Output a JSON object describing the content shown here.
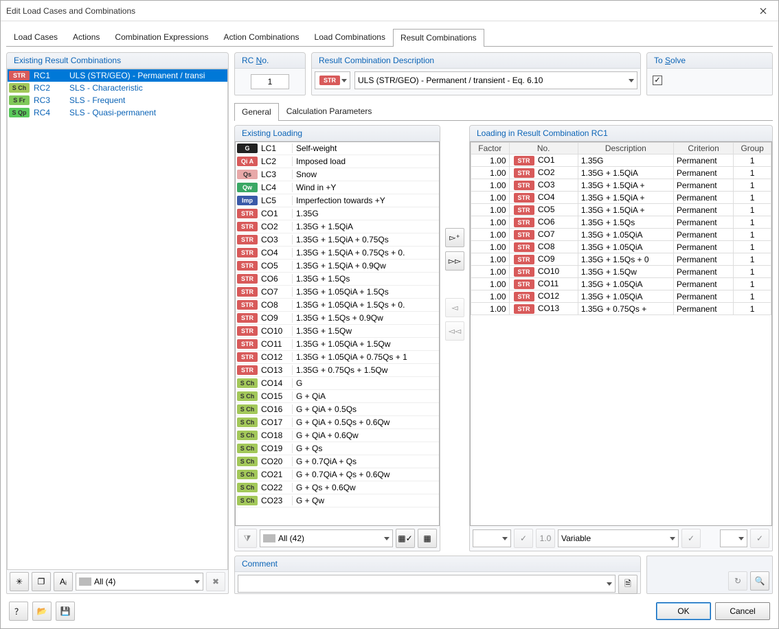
{
  "window": {
    "title": "Edit Load Cases and Combinations"
  },
  "mainTabs": [
    "Load Cases",
    "Actions",
    "Combination Expressions",
    "Action Combinations",
    "Load Combinations",
    "Result Combinations"
  ],
  "mainTabActive": 5,
  "left": {
    "header": "Existing Result Combinations",
    "rows": [
      {
        "tag": "STR",
        "tagcls": "tag-STR",
        "num": "RC1",
        "desc": "ULS (STR/GEO) - Permanent / transi",
        "sel": true
      },
      {
        "tag": "S Ch",
        "tagcls": "tag-SCh",
        "num": "RC2",
        "desc": "SLS - Characteristic"
      },
      {
        "tag": "S Fr",
        "tagcls": "tag-SFr",
        "num": "RC3",
        "desc": "SLS - Frequent"
      },
      {
        "tag": "S Qp",
        "tagcls": "tag-SQp",
        "num": "RC4",
        "desc": "SLS - Quasi-permanent"
      }
    ],
    "filter": "All (4)"
  },
  "rcNo": {
    "header": "RC No.",
    "value": "1"
  },
  "rcDesc": {
    "header": "Result Combination Description",
    "badge": "STR",
    "value": "ULS (STR/GEO) - Permanent / transient - Eq. 6.10"
  },
  "solve": {
    "header": "To Solve",
    "checked": true
  },
  "subTabs": [
    "General",
    "Calculation Parameters"
  ],
  "subTabActive": 0,
  "existLoad": {
    "header": "Existing Loading",
    "rows": [
      {
        "tag": "G",
        "tagcls": "tag-G",
        "code": "LC1",
        "desc": "Self-weight"
      },
      {
        "tag": "Qi A",
        "tagcls": "tag-QiA",
        "code": "LC2",
        "desc": "Imposed load"
      },
      {
        "tag": "Qs",
        "tagcls": "tag-Qs",
        "code": "LC3",
        "desc": "Snow"
      },
      {
        "tag": "Qw",
        "tagcls": "tag-Qw",
        "code": "LC4",
        "desc": "Wind in +Y"
      },
      {
        "tag": "Imp",
        "tagcls": "tag-Imp",
        "code": "LC5",
        "desc": "Imperfection towards +Y"
      },
      {
        "tag": "STR",
        "tagcls": "tag-STR",
        "code": "CO1",
        "desc": "1.35G"
      },
      {
        "tag": "STR",
        "tagcls": "tag-STR",
        "code": "CO2",
        "desc": "1.35G + 1.5QiA"
      },
      {
        "tag": "STR",
        "tagcls": "tag-STR",
        "code": "CO3",
        "desc": "1.35G + 1.5QiA + 0.75Qs"
      },
      {
        "tag": "STR",
        "tagcls": "tag-STR",
        "code": "CO4",
        "desc": "1.35G + 1.5QiA + 0.75Qs + 0."
      },
      {
        "tag": "STR",
        "tagcls": "tag-STR",
        "code": "CO5",
        "desc": "1.35G + 1.5QiA + 0.9Qw"
      },
      {
        "tag": "STR",
        "tagcls": "tag-STR",
        "code": "CO6",
        "desc": "1.35G + 1.5Qs"
      },
      {
        "tag": "STR",
        "tagcls": "tag-STR",
        "code": "CO7",
        "desc": "1.35G + 1.05QiA + 1.5Qs"
      },
      {
        "tag": "STR",
        "tagcls": "tag-STR",
        "code": "CO8",
        "desc": "1.35G + 1.05QiA + 1.5Qs + 0."
      },
      {
        "tag": "STR",
        "tagcls": "tag-STR",
        "code": "CO9",
        "desc": "1.35G + 1.5Qs + 0.9Qw"
      },
      {
        "tag": "STR",
        "tagcls": "tag-STR",
        "code": "CO10",
        "desc": "1.35G + 1.5Qw"
      },
      {
        "tag": "STR",
        "tagcls": "tag-STR",
        "code": "CO11",
        "desc": "1.35G + 1.05QiA + 1.5Qw"
      },
      {
        "tag": "STR",
        "tagcls": "tag-STR",
        "code": "CO12",
        "desc": "1.35G + 1.05QiA + 0.75Qs + 1"
      },
      {
        "tag": "STR",
        "tagcls": "tag-STR",
        "code": "CO13",
        "desc": "1.35G + 0.75Qs + 1.5Qw"
      },
      {
        "tag": "S Ch",
        "tagcls": "tag-SCh",
        "code": "CO14",
        "desc": "G"
      },
      {
        "tag": "S Ch",
        "tagcls": "tag-SCh",
        "code": "CO15",
        "desc": "G + QiA"
      },
      {
        "tag": "S Ch",
        "tagcls": "tag-SCh",
        "code": "CO16",
        "desc": "G + QiA + 0.5Qs"
      },
      {
        "tag": "S Ch",
        "tagcls": "tag-SCh",
        "code": "CO17",
        "desc": "G + QiA + 0.5Qs + 0.6Qw"
      },
      {
        "tag": "S Ch",
        "tagcls": "tag-SCh",
        "code": "CO18",
        "desc": "G + QiA + 0.6Qw"
      },
      {
        "tag": "S Ch",
        "tagcls": "tag-SCh",
        "code": "CO19",
        "desc": "G + Qs"
      },
      {
        "tag": "S Ch",
        "tagcls": "tag-SCh",
        "code": "CO20",
        "desc": "G + 0.7QiA + Qs"
      },
      {
        "tag": "S Ch",
        "tagcls": "tag-SCh",
        "code": "CO21",
        "desc": "G + 0.7QiA + Qs + 0.6Qw"
      },
      {
        "tag": "S Ch",
        "tagcls": "tag-SCh",
        "code": "CO22",
        "desc": "G + Qs + 0.6Qw"
      },
      {
        "tag": "S Ch",
        "tagcls": "tag-SCh",
        "code": "CO23",
        "desc": "G + Qw"
      }
    ],
    "filter": "All (42)"
  },
  "rcRes": {
    "header": "Loading in Result Combination RC1",
    "cols": [
      "Factor",
      "No.",
      "Description",
      "Criterion",
      "Group"
    ],
    "rows": [
      {
        "f": "1.00",
        "tag": "STR",
        "no": "CO1",
        "d": "1.35G",
        "c": "Permanent",
        "g": "1"
      },
      {
        "f": "1.00",
        "tag": "STR",
        "no": "CO2",
        "d": "1.35G + 1.5QiA",
        "c": "Permanent",
        "g": "1"
      },
      {
        "f": "1.00",
        "tag": "STR",
        "no": "CO3",
        "d": "1.35G + 1.5QiA +",
        "c": "Permanent",
        "g": "1"
      },
      {
        "f": "1.00",
        "tag": "STR",
        "no": "CO4",
        "d": "1.35G + 1.5QiA +",
        "c": "Permanent",
        "g": "1"
      },
      {
        "f": "1.00",
        "tag": "STR",
        "no": "CO5",
        "d": "1.35G + 1.5QiA +",
        "c": "Permanent",
        "g": "1"
      },
      {
        "f": "1.00",
        "tag": "STR",
        "no": "CO6",
        "d": "1.35G + 1.5Qs",
        "c": "Permanent",
        "g": "1"
      },
      {
        "f": "1.00",
        "tag": "STR",
        "no": "CO7",
        "d": "1.35G + 1.05QiA",
        "c": "Permanent",
        "g": "1"
      },
      {
        "f": "1.00",
        "tag": "STR",
        "no": "CO8",
        "d": "1.35G + 1.05QiA",
        "c": "Permanent",
        "g": "1"
      },
      {
        "f": "1.00",
        "tag": "STR",
        "no": "CO9",
        "d": "1.35G + 1.5Qs + 0",
        "c": "Permanent",
        "g": "1"
      },
      {
        "f": "1.00",
        "tag": "STR",
        "no": "CO10",
        "d": "1.35G + 1.5Qw",
        "c": "Permanent",
        "g": "1"
      },
      {
        "f": "1.00",
        "tag": "STR",
        "no": "CO11",
        "d": "1.35G + 1.05QiA",
        "c": "Permanent",
        "g": "1"
      },
      {
        "f": "1.00",
        "tag": "STR",
        "no": "CO12",
        "d": "1.35G + 1.05QiA",
        "c": "Permanent",
        "g": "1"
      },
      {
        "f": "1.00",
        "tag": "STR",
        "no": "CO13",
        "d": "1.35G + 0.75Qs +",
        "c": "Permanent",
        "g": "1"
      }
    ],
    "factorDefault": "1.0",
    "crit": "Variable"
  },
  "comment": {
    "header": "Comment",
    "value": ""
  },
  "buttons": {
    "ok": "OK",
    "cancel": "Cancel"
  }
}
